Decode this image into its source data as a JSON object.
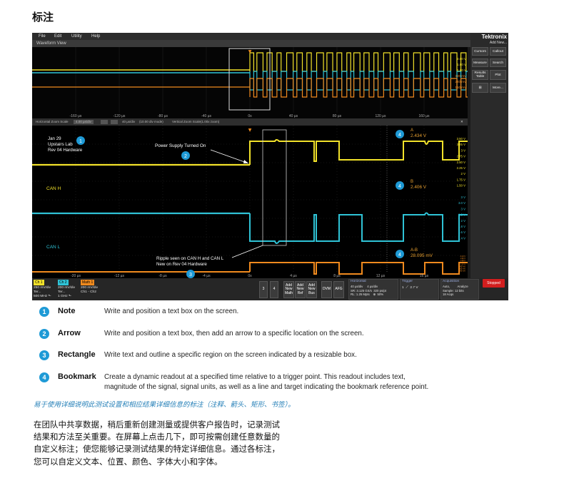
{
  "heading": "标注",
  "menu": [
    "File",
    "Edit",
    "Utility",
    "Help"
  ],
  "window_title": "Waveform View",
  "brand": "Tektronix",
  "add_new": "Add New...",
  "right_buttons": [
    "Cursors",
    "Callout",
    "Measure",
    "Search",
    "Results Table",
    "Plot",
    "⊞",
    "More..."
  ],
  "overview_time_labels": [
    "-160 µs",
    "-120 µs",
    "-80 µs",
    "-40 µs",
    "0s",
    "40 µs",
    "80 µs",
    "120 µs",
    "160 µs"
  ],
  "overview_right_labels": [
    "2.00 V",
    "1.80 V",
    "1.60 V",
    "320 mV",
    "240 mV",
    "160 mV"
  ],
  "zoom_bar": {
    "label": "Horizontal Zoom Scale",
    "scale": "4.00 µs/div",
    "pos_label": "40 µs/div",
    "pos_value": "(10.00 div mode)",
    "zoom_pos_label": "Vertical Zoom Scale",
    "zoom_pos_value": "(1.00x zoom)"
  },
  "channel_labels": [
    "CAN H",
    "CAN L"
  ],
  "note": {
    "badge": "1",
    "lines": [
      "Jan 29",
      "Upstairs Lab",
      "Rev 04 Hardware"
    ]
  },
  "arrow_note": {
    "badge": "2",
    "text": "Power Supply Turned On"
  },
  "rect_note": {
    "badge": "3",
    "lines": [
      "Ripple seen on CAN H and CAN L",
      "New on Rev 04 Hardware"
    ]
  },
  "bookmarks": [
    {
      "badge": "4",
      "label": "A",
      "value": "2.434 V"
    },
    {
      "badge": "4",
      "label": "B",
      "value": "2.406 V"
    },
    {
      "badge": "4",
      "label": "A-B",
      "value": "28.095 mV"
    }
  ],
  "main_time_labels": [
    "-20 µs",
    "-12 µs",
    "-8 µs",
    "-4 µs",
    "0s",
    "4 µs",
    "8 µs",
    "12 µs",
    "16 µs"
  ],
  "main_right_labels_1": [
    "3.50 V",
    "3.25 V",
    "3 V",
    "2.75 V",
    "2.50 V",
    "2.25 V",
    "2 V",
    "1.75 V",
    "1.50 V"
  ],
  "main_right_labels_2": [
    "3 V",
    "3.0 V",
    "3 V",
    "2.5 V",
    "2 V",
    "1.8 V",
    "1.6 V",
    "1.4 V"
  ],
  "main_right_labels_3": [
    "2.24 V",
    "1.96 V",
    "1.68 V",
    "1.40 V",
    "1.12 V",
    "840 mV",
    "560 mV",
    "280 mV"
  ],
  "bottom_bar": {
    "ch1": {
      "badge": "Ch 1",
      "lines": "250 mV/div\nTer...\n500 MHz ⬑"
    },
    "ch2": {
      "badge": "Ch 2",
      "lines": "200 mV/div\nTer...\n1 GHz ⬑"
    },
    "math1": {
      "badge": "Math 1",
      "lines": "200 mV/div\nCh1 - Ch2"
    },
    "num_buttons": [
      "3",
      "4"
    ],
    "add_buttons": [
      "Add\nNew\nMath",
      "Add\nNew\nRef",
      "Add\nNew\nBus"
    ],
    "dvm": "DVM",
    "afg": "AFG",
    "horizontal": {
      "title": "Horizontal",
      "lines": "40 µs/div     4 µs/div\nSR: 3.125 GS/s  320 ps/pt\nRL: 1.25 Mpts    ⊕  50%"
    },
    "trigger": {
      "title": "Trigger",
      "lines": "1  ⟋  2.7 V"
    },
    "acquisition": {
      "title": "Acquisition",
      "lines": "Auto,         Analyze\nSample: 12 bits\n18 Acqs"
    },
    "stopped": "Stopped"
  },
  "legend": [
    {
      "num": "1",
      "term": "Note",
      "desc": "Write and position a text box on the screen."
    },
    {
      "num": "2",
      "term": "Arrow",
      "desc": "Write and position a text box, then add an arrow to a specific location on the screen."
    },
    {
      "num": "3",
      "term": "Rectangle",
      "desc": "Write text and outline a specific region on the screen indicated by a resizable box."
    },
    {
      "num": "4",
      "term": "Bookmark",
      "desc": "Create a dynamic readout at a specified time relative to a trigger point. This readout includes text, magnitude of the signal, signal units, as well as a line and target indicating the bookmark reference point."
    }
  ],
  "caption": "易于使用详细说明此测试设置和相应结果详细信息的标注（注释、箭头、矩形、书签）。",
  "paragraph": "在团队中共享数据，稍后重新创建测量或提供客户报告时，记录测试结果和方法至关重要。在屏幕上点击几下，即可按需创建任意数量的自定义标注；使您能够记录测试结果的特定详细信息。通过各标注，您可以自定义文本、位置、颜色、字体大小和字体。",
  "colors": {
    "ch1": "#f2e22a",
    "ch2": "#2fc3d6",
    "math": "#f08a1e",
    "accent": "#1e9ad6",
    "stopped": "#d21e1e"
  }
}
